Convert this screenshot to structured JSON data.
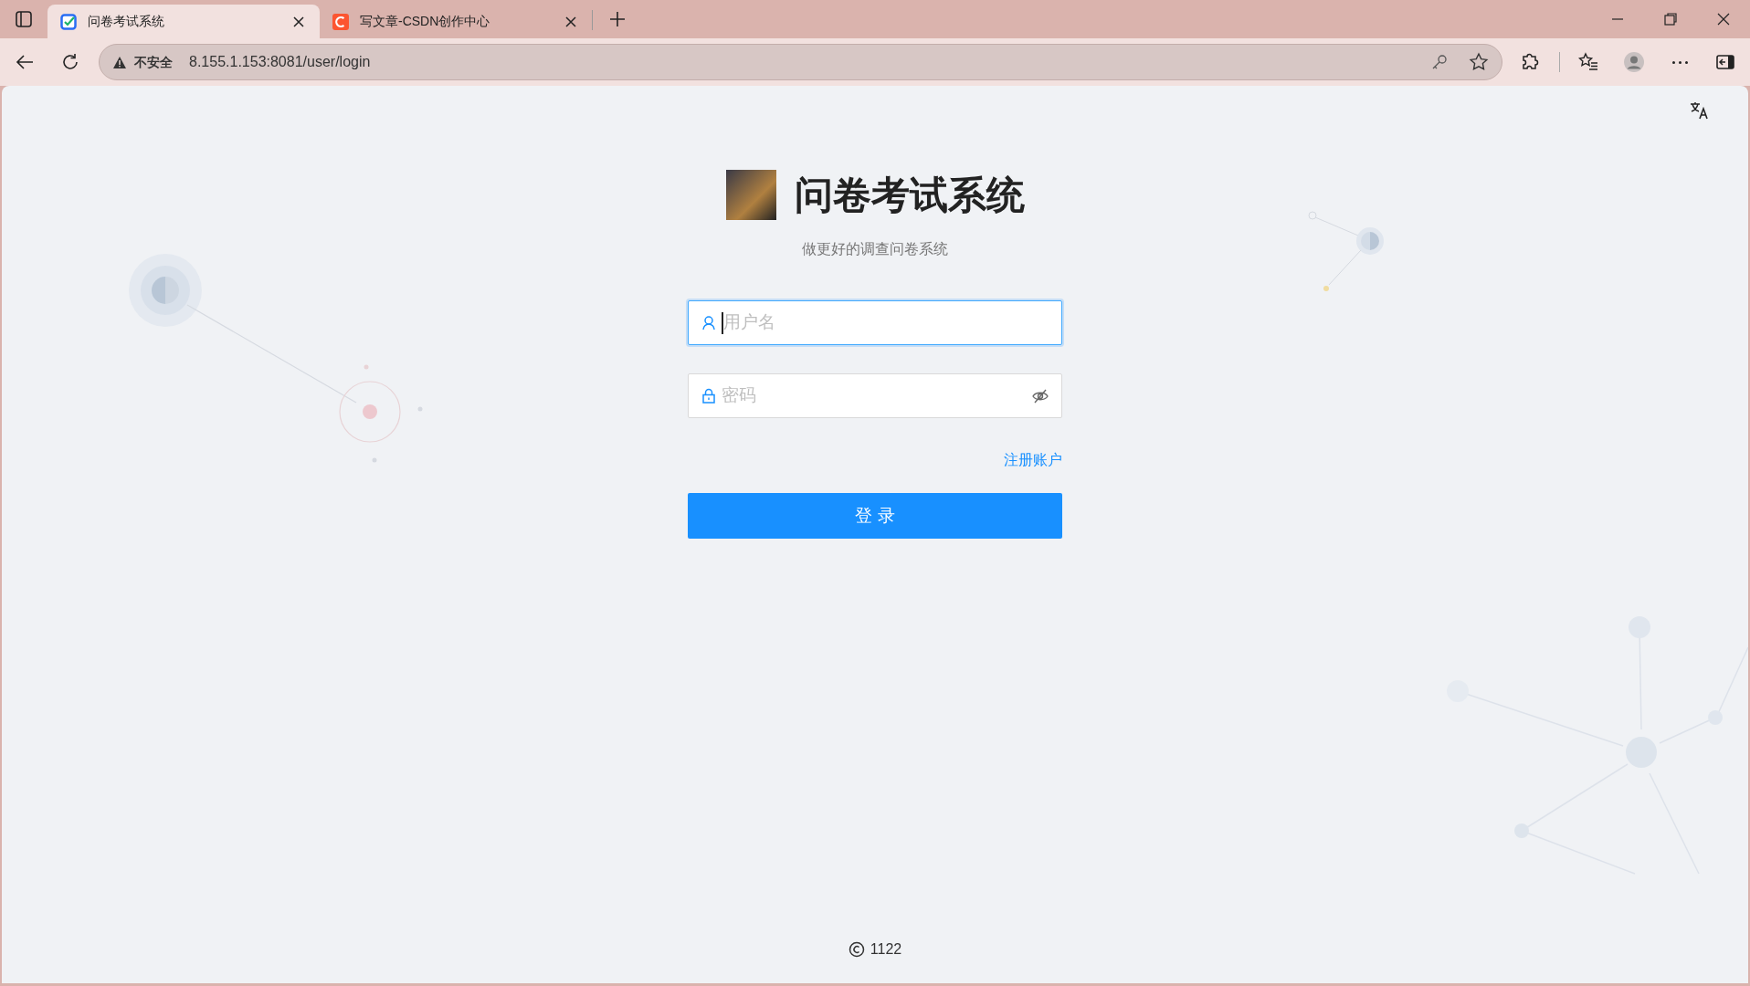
{
  "browser": {
    "tabs": [
      {
        "title": "问卷考试系统",
        "selected": true,
        "kind": "checklist"
      },
      {
        "title": "写文章-CSDN创作中心",
        "selected": false,
        "kind": "csdn"
      }
    ],
    "address_bar": {
      "security": "不安全",
      "url": "8.155.1.153:8081/user/login"
    }
  },
  "login": {
    "title": "问卷考试系统",
    "subtitle": "做更好的调查问卷系统",
    "fields": [
      {
        "kind": "username",
        "placeholder": "用户名",
        "focused": true
      },
      {
        "kind": "password",
        "placeholder": "密码",
        "focused": false
      }
    ],
    "register_link": "注册账户",
    "login_button": "登 录"
  },
  "footer": {
    "text": "1122"
  }
}
